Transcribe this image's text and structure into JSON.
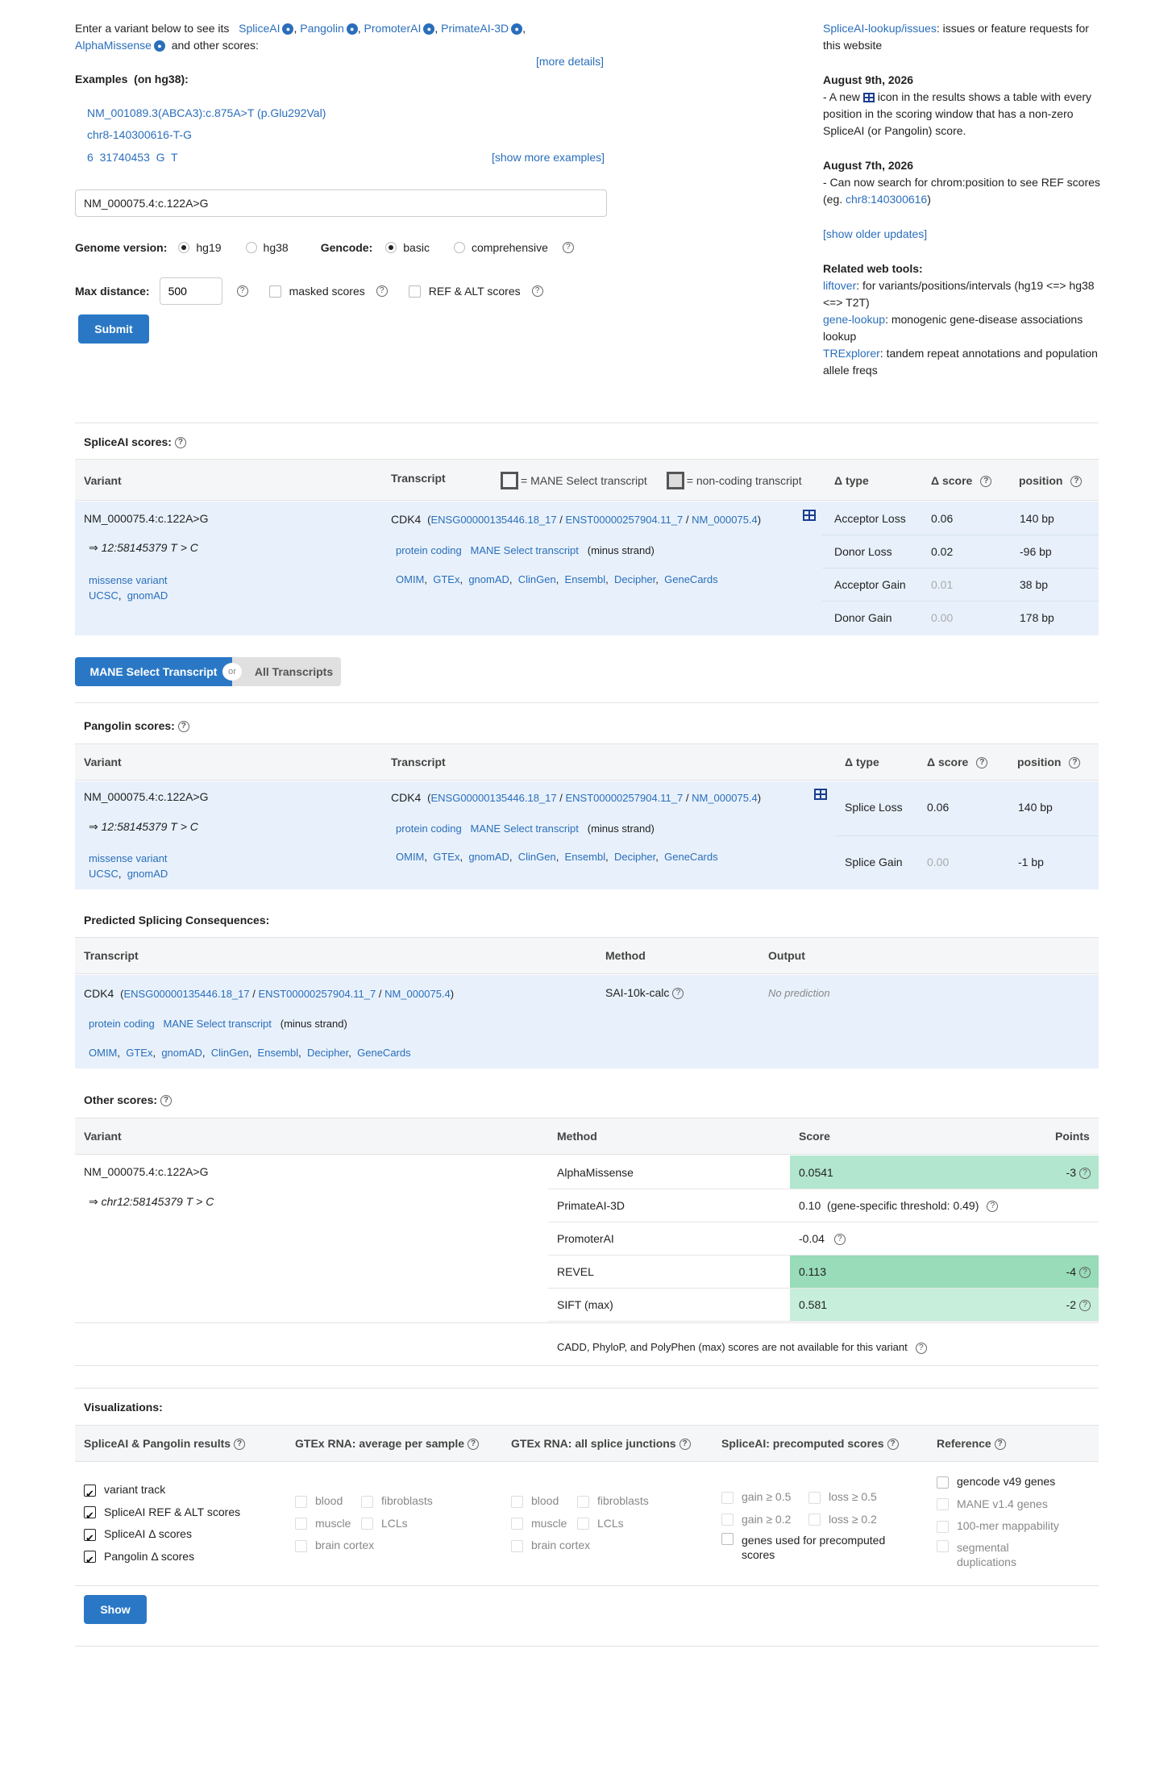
{
  "intro": {
    "line1": "Enter a variant below to see its",
    "tools": [
      "SpliceAI",
      "Pangolin",
      "PromoterAI",
      "PrimateAI-3D",
      "AlphaMissense"
    ],
    "other_scores": "and other scores:",
    "more_details": "[more details]"
  },
  "examples": {
    "title": "Examples",
    "build": "(on hg38):",
    "items": [
      "NM_001089.3(ABCA3):c.875A>T (p.Glu292Val)",
      "chr8-140300616-T-G",
      "6  31740453  G  T"
    ],
    "show_more": "[show more examples]"
  },
  "search": {
    "value": "NM_000075.4:c.122A>G"
  },
  "options": {
    "genome_label": "Genome version:",
    "genome_opts": [
      "hg19",
      "hg38"
    ],
    "gencode_label": "Gencode:",
    "gencode_opts": [
      "basic",
      "comprehensive"
    ],
    "maxdist_label": "Max distance:",
    "maxdist_value": "500",
    "masked": "masked scores",
    "refalt": "REF & ALT scores",
    "submit": "Submit"
  },
  "news": {
    "issues_link": "SpliceAI-lookup/issues",
    "issues_text": ": issues or feature requests for this website",
    "update1_date": "August 9th, 2026",
    "update1_a": "- A new",
    "update1_b": "icon in the results shows a table with every position in the scoring window that has a non-zero SpliceAI (or Pangolin) score.",
    "update2_date": "August 7th, 2026",
    "update2_a": "- Can now search for chrom:position to see REF scores (eg.",
    "update2_link": "chr8:140300616",
    "update2_b": ")",
    "older": "[show older updates]",
    "tools_title": "Related web tools:",
    "tool1_link": "liftover",
    "tool1_text": ": for variants/positions/intervals (hg19 <=> hg38 <=> T2T)",
    "tool2_link": "gene-lookup",
    "tool2_text": ": monogenic gene-disease associations lookup",
    "tool3_link": "TRExplorer",
    "tool3_text": ": tandem repeat annotations and population allele freqs"
  },
  "spliceai": {
    "title": "SpliceAI scores:",
    "col_variant": "Variant",
    "col_transcript": "Transcript",
    "legend_mane": "= MANE Select transcript",
    "legend_noncoding": "= non-coding transcript",
    "col_type": "Δ type",
    "col_score": "Δ score",
    "col_position": "position",
    "variant": "NM_000075.4:c.122A>G",
    "coord": "⇒ 12:58145379 T > C",
    "consequence": "missense variant",
    "links": [
      "UCSC",
      "gnomAD"
    ],
    "gene": "CDK4",
    "ids": [
      "ENSG00000135446.18_17",
      "ENST00000257904.11_7",
      "NM_000075.4"
    ],
    "biotype": "protein coding",
    "mane": "MANE Select transcript",
    "strand": "(minus strand)",
    "xrefs": [
      "OMIM",
      "GTEx",
      "gnomAD",
      "ClinGen",
      "Ensembl",
      "Decipher",
      "GeneCards"
    ],
    "rows": [
      {
        "type": "Acceptor Loss",
        "score": "0.06",
        "pos": "140 bp"
      },
      {
        "type": "Donor Loss",
        "score": "0.02",
        "pos": "-96 bp"
      },
      {
        "type": "Acceptor Gain",
        "score": "0.01",
        "pos": "38 bp"
      },
      {
        "type": "Donor Gain",
        "score": "0.00",
        "pos": "178 bp"
      }
    ]
  },
  "toggle": {
    "left": "MANE Select Transcript",
    "or": "or",
    "right": "All Transcripts"
  },
  "pangolin": {
    "title": "Pangolin scores:",
    "col_variant": "Variant",
    "col_transcript": "Transcript",
    "col_type": "Δ type",
    "col_score": "Δ score",
    "col_position": "position",
    "variant": "NM_000075.4:c.122A>G",
    "coord": "⇒ 12:58145379 T > C",
    "consequence": "missense variant",
    "links": [
      "UCSC",
      "gnomAD"
    ],
    "gene": "CDK4",
    "ids": [
      "ENSG00000135446.18_17",
      "ENST00000257904.11_7",
      "NM_000075.4"
    ],
    "biotype": "protein coding",
    "mane": "MANE Select transcript",
    "strand": "(minus strand)",
    "xrefs": [
      "OMIM",
      "GTEx",
      "gnomAD",
      "ClinGen",
      "Ensembl",
      "Decipher",
      "GeneCards"
    ],
    "rows": [
      {
        "type": "Splice Loss",
        "score": "0.06",
        "pos": "140 bp"
      },
      {
        "type": "Splice Gain",
        "score": "0.00",
        "pos": "-1 bp"
      }
    ]
  },
  "consequences": {
    "title": "Predicted Splicing Consequences:",
    "col_transcript": "Transcript",
    "col_method": "Method",
    "col_output": "Output",
    "gene": "CDK4",
    "ids": [
      "ENSG00000135446.18_17",
      "ENST00000257904.11_7",
      "NM_000075.4"
    ],
    "biotype": "protein coding",
    "mane": "MANE Select transcript",
    "strand": "(minus strand)",
    "xrefs": [
      "OMIM",
      "GTEx",
      "gnomAD",
      "ClinGen",
      "Ensembl",
      "Decipher",
      "GeneCards"
    ],
    "method": "SAI-10k-calc",
    "output": "No prediction"
  },
  "other": {
    "title": "Other scores:",
    "col_variant": "Variant",
    "col_method": "Method",
    "col_score": "Score",
    "col_points": "Points",
    "variant": "NM_000075.4:c.122A>G",
    "coord": "⇒ chr12:58145379 T > C",
    "rows": [
      {
        "method": "AlphaMissense",
        "score": "0.0541",
        "extra": "",
        "points": "-3",
        "color": "#b3e6cf"
      },
      {
        "method": "PrimateAI-3D",
        "score": "0.10",
        "extra": "(gene-specific threshold: 0.49)",
        "points": "",
        "color": ""
      },
      {
        "method": "PromoterAI",
        "score": "-0.04",
        "extra": "",
        "points": "",
        "color": ""
      },
      {
        "method": "REVEL",
        "score": "0.113",
        "extra": "",
        "points": "-4",
        "color": "#98dcb9"
      },
      {
        "method": "SIFT (max)",
        "score": "0.581",
        "extra": "",
        "points": "-2",
        "color": "#c6eedb"
      }
    ],
    "note": "CADD,  PhyloP,  and PolyPhen (max) scores are not available for this variant"
  },
  "viz": {
    "title": "Visualizations:",
    "col1": "SpliceAI & Pangolin results",
    "col2": "GTEx RNA: average per sample",
    "col3": "GTEx RNA: all splice junctions",
    "col4": "SpliceAI: precomputed scores",
    "col5": "Reference",
    "c1": [
      "variant track",
      "SpliceAI REF & ALT scores",
      "SpliceAI Δ  scores",
      "Pangolin Δ  scores"
    ],
    "c2": [
      "blood",
      "fibroblasts",
      "muscle",
      "LCLs",
      "brain cortex"
    ],
    "c3": [
      "blood",
      "fibroblasts",
      "muscle",
      "LCLs",
      "brain cortex"
    ],
    "c4": [
      "gain ≥ 0.5",
      "loss ≥ 0.5",
      "gain ≥ 0.2",
      "loss ≥ 0.2",
      "genes used for precomputed scores"
    ],
    "c5": [
      "gencode v49 genes",
      "MANE v1.4 genes",
      "100-mer mappability",
      "segmental duplications"
    ],
    "show": "Show"
  }
}
